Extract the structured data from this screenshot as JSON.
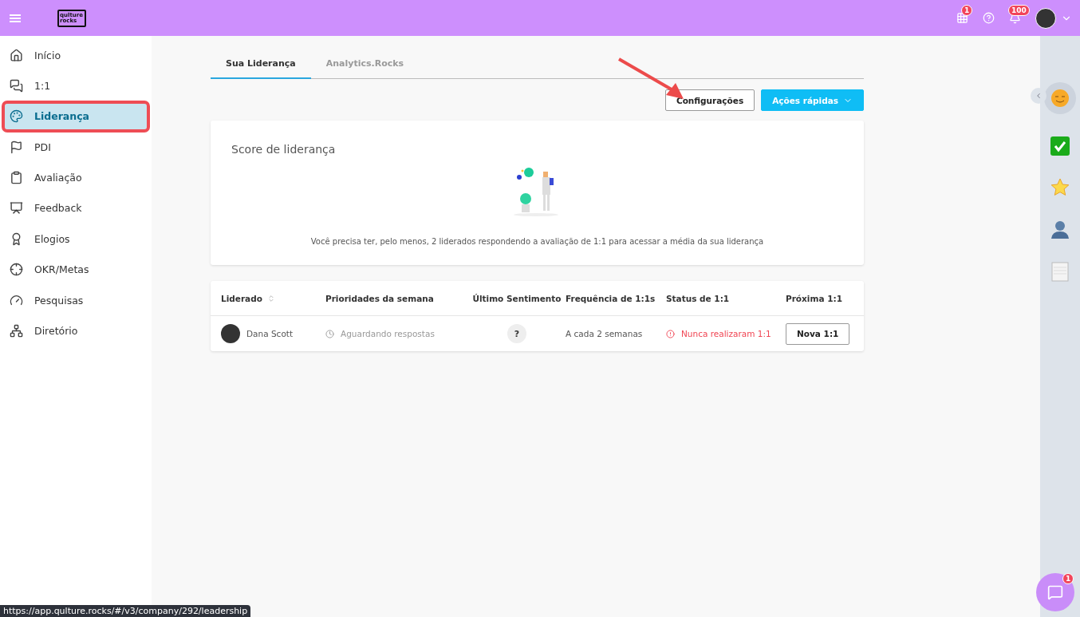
{
  "topbar": {
    "logo": "qulture rocks",
    "apps_badge": "1",
    "notifications_badge": "100"
  },
  "sidebar": {
    "items": [
      {
        "label": "Início",
        "kind": "home",
        "selected": false
      },
      {
        "label": "1:1",
        "kind": "chats",
        "selected": false
      },
      {
        "label": "Liderança",
        "kind": "palette",
        "selected": true
      },
      {
        "label": "PDI",
        "kind": "flag",
        "selected": false
      },
      {
        "label": "Avaliação",
        "kind": "clipboard",
        "selected": false
      },
      {
        "label": "Feedback",
        "kind": "feedback",
        "selected": false
      },
      {
        "label": "Elogios",
        "kind": "award",
        "selected": false
      },
      {
        "label": "OKR/Metas",
        "kind": "target",
        "selected": false
      },
      {
        "label": "Pesquisas",
        "kind": "gauge",
        "selected": false
      },
      {
        "label": "Diretório",
        "kind": "network",
        "selected": false
      }
    ]
  },
  "tabs": [
    {
      "label": "Sua Liderança",
      "selected": true
    },
    {
      "label": "Analytics.Rocks",
      "selected": false
    }
  ],
  "actions": {
    "settings": "Configurações",
    "quick": "Ações rápidas"
  },
  "score_card": {
    "title": "Score de liderança",
    "message": "Você precisa ter, pelo menos, 2 liderados respondendo a avaliação de 1:1 para acessar a média da sua liderança"
  },
  "table": {
    "columns": [
      {
        "label": "Liderado",
        "sortable": true
      },
      {
        "label": "Prioridades da semana",
        "sortable": false
      },
      {
        "label": "Último Sentimento",
        "sortable": false
      },
      {
        "label": "Frequência de 1:1s",
        "sortable": false
      },
      {
        "label": "Status de 1:1",
        "sortable": false
      },
      {
        "label": "Próxima 1:1",
        "sortable": false
      }
    ],
    "rows": [
      {
        "name": "Dana Scott",
        "priorities": "Aguardando respostas",
        "sentiment": "?",
        "frequency": "A cada 2 semanas",
        "status": "Nunca realizaram 1:1",
        "action": "Nova 1:1"
      }
    ]
  },
  "chat_badge": "1",
  "status_url": "https://app.qulture.rocks/#/v3/company/292/leadership"
}
